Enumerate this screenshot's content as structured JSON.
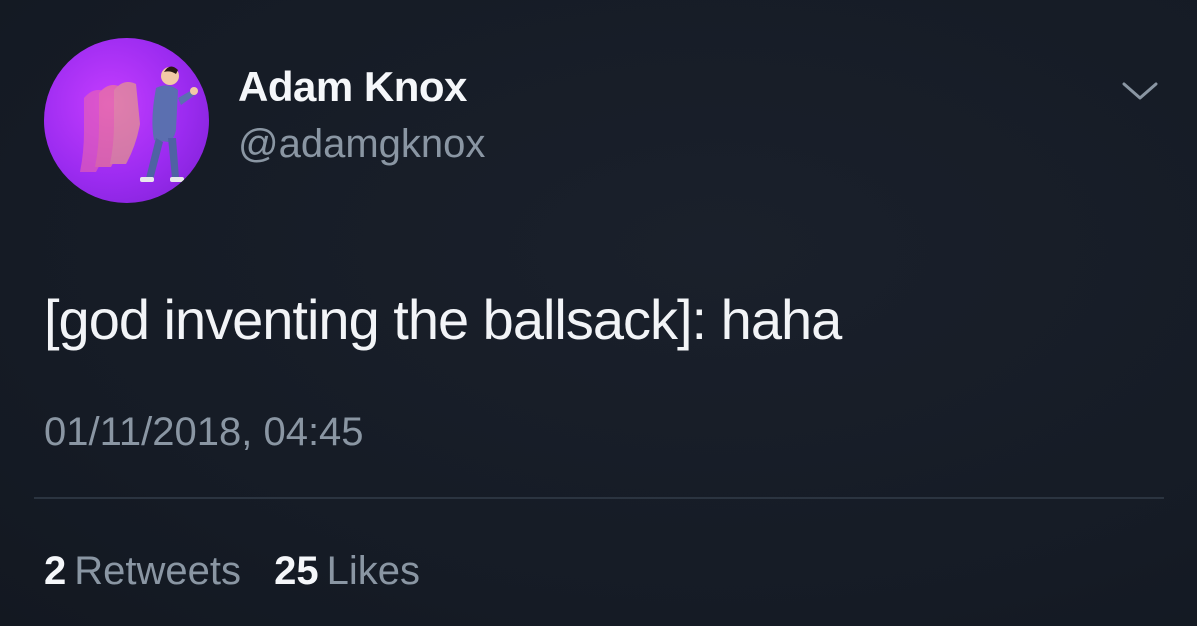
{
  "author": {
    "display_name": "Adam Knox",
    "handle": "@adamgknox",
    "avatar_icon": "profile-avatar-running-man"
  },
  "tweet": {
    "text": "[god inventing the ballsack]: haha",
    "timestamp": "01/11/2018, 04:45"
  },
  "stats": {
    "retweets_count": "2",
    "retweets_label": "Retweets",
    "likes_count": "25",
    "likes_label": "Likes"
  },
  "icons": {
    "menu": "chevron-down-icon"
  },
  "colors": {
    "background": "#161c27",
    "secondary_text": "#8a96a3",
    "primary_text": "#f5f7fa",
    "avatar_purple": "#9b2bf0",
    "divider": "#2b3440"
  }
}
